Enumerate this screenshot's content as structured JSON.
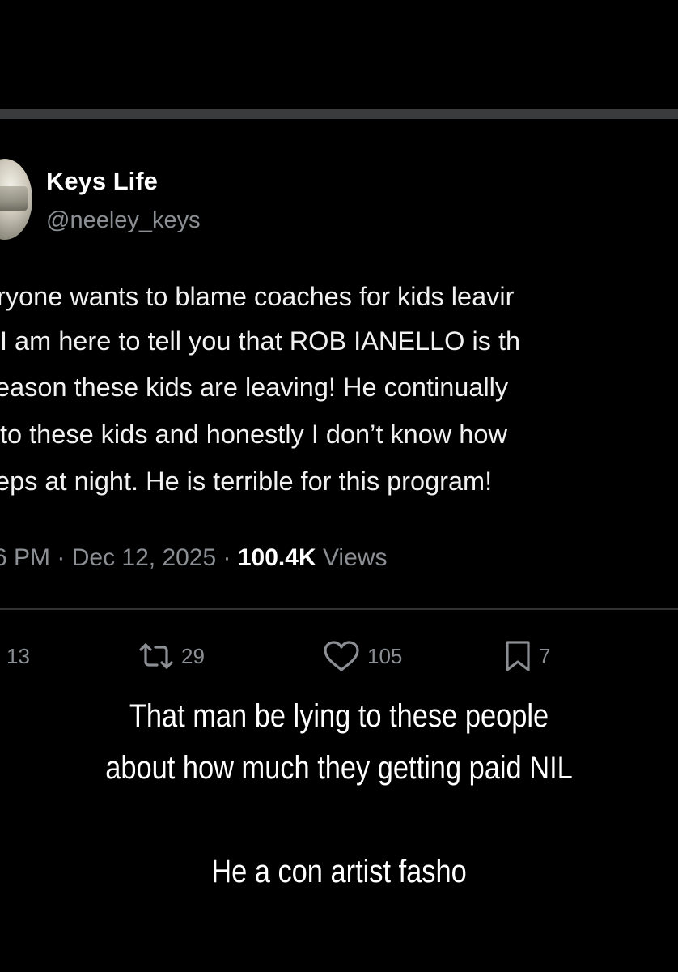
{
  "colors": {
    "background": "#000000",
    "text_primary": "#ffffff",
    "text_secondary": "#8b8f94",
    "divider": "#2f3336"
  },
  "tweet": {
    "author": {
      "display_name": "Keys Life",
      "handle": "@neeley_keys",
      "avatar_icon": "profile-photo"
    },
    "body_lines": [
      "ryone wants to blame coaches for kids leavir",
      " I am here to tell you that  ROB IANELLO is th",
      "eason these kids are leaving! He continually",
      " to these kids and honestly I don’t know how",
      "eps at night. He is terrible for this program!"
    ],
    "meta": {
      "time": "6 PM",
      "separator": "·",
      "date": "Dec 12, 2025",
      "views_count": "100.4K",
      "views_label": "Views"
    },
    "actions": {
      "replies": "13",
      "reposts": "29",
      "likes": "105",
      "bookmarks": "7"
    }
  },
  "overlay": {
    "line1": "That man be lying to these people",
    "line2": "about how much they getting paid NIL",
    "line3": "He a con artist fasho"
  }
}
